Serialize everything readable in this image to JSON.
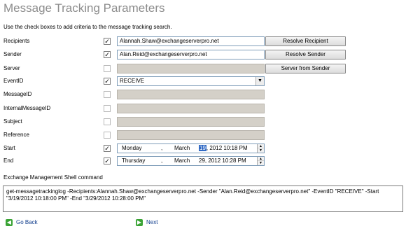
{
  "page": {
    "title": "Message Tracking Parameters",
    "subtitle": "Use the check boxes to add criteria to the message tracking search."
  },
  "criteria": {
    "recipients": {
      "label": "Recipients",
      "checked": true,
      "value": "Alannah.Shaw@exchangeserverpro.net",
      "button": "Resolve Recipient"
    },
    "sender": {
      "label": "Sender",
      "checked": true,
      "value": "Alan.Reid@exchangeserverpro.net",
      "button": "Resolve Sender"
    },
    "server": {
      "label": "Server",
      "checked": false,
      "value": "",
      "button": "Server from Sender"
    },
    "eventid": {
      "label": "EventID",
      "checked": true,
      "value": "RECEIVE"
    },
    "messageid": {
      "label": "MessageID",
      "checked": false,
      "value": ""
    },
    "internalmessageid": {
      "label": "InternalMessageID",
      "checked": false,
      "value": ""
    },
    "subject": {
      "label": "Subject",
      "checked": false,
      "value": ""
    },
    "reference": {
      "label": "Reference",
      "checked": false,
      "value": ""
    },
    "start": {
      "label": "Start",
      "checked": true,
      "weekday": "Monday",
      "month": "March",
      "day": "19",
      "rest": ", 2012 10:18 PM"
    },
    "end": {
      "label": "End",
      "checked": true,
      "weekday": "Thursday",
      "month": "March",
      "day": "29",
      "rest": ", 2012 10:28 PM"
    }
  },
  "shell": {
    "label": "Exchange Management Shell command",
    "command": "get-messagetrackinglog -Recipients:Alannah.Shaw@exchangeserverpro.net -Sender \"Alan.Reid@exchangeserverpro.net\" -EventID \"RECEIVE\" -Start \"3/19/2012 10:18:00 PM\" -End \"3/29/2012 10:28:00 PM\""
  },
  "nav": {
    "back": "Go Back",
    "next": "Next"
  },
  "glyphs": {
    "check": "✓",
    "dropdown": "▼",
    "comma": ",",
    "up": "▲",
    "down": "▼",
    "back_arrow": "◀",
    "next_arrow": "▶"
  },
  "colors": {
    "title": "#8c8c8c",
    "selection": "#316ac5",
    "nav_icon": "#3aa335",
    "disabled_field": "#d4d0c8"
  }
}
